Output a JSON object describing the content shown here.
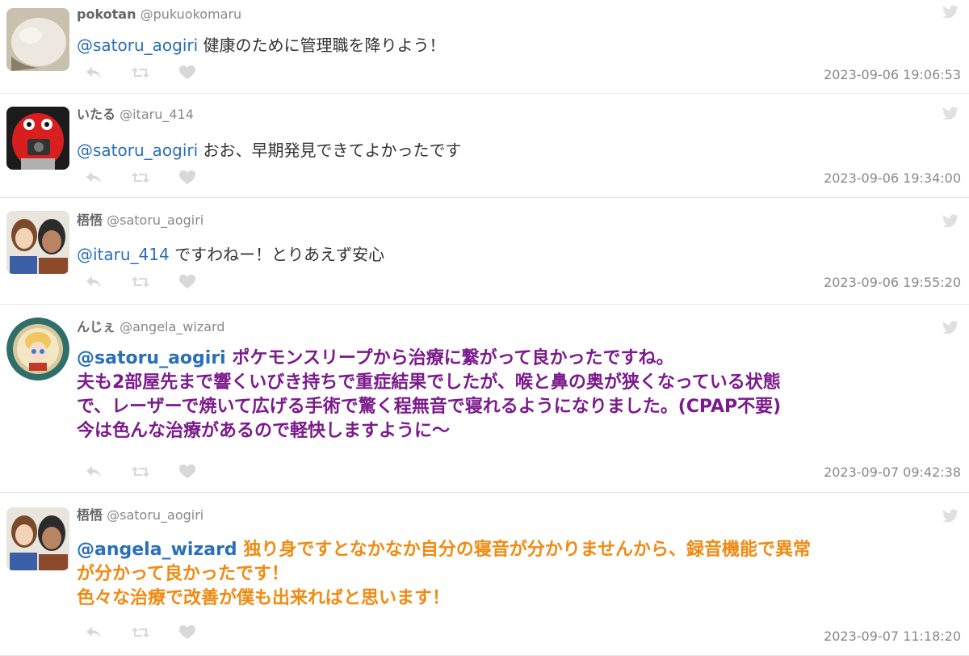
{
  "tweets": [
    {
      "name": "pokotan",
      "handle": "@pukuokomaru",
      "mention": "@satoru_aogiri",
      "text": "健康のために管理職を降りよう！",
      "time": "2023-09-06 19:06:53",
      "avatar": "avatar-round-white"
    },
    {
      "name": "いたる",
      "handle": "@itaru_414",
      "mention": "@satoru_aogiri",
      "text": "おお、早期発見できてよかったです",
      "time": "2023-09-06 19:34:00",
      "avatar": "avatar-red-creature"
    },
    {
      "name": "梧悟",
      "handle": "@satoru_aogiri",
      "mention": "@itaru_414",
      "text": "ですわねー！とりあえず安心",
      "time": "2023-09-06 19:55:20",
      "avatar": "avatar-anime-pair"
    },
    {
      "name": "んじぇ",
      "handle": "@angela_wizard",
      "mention": "@satoru_aogiri",
      "text_lines": [
        "ポケモンスリープから治療に繋がって良かったですね。",
        "夫も2部屋先まで響くいびき持ちで重症結果でしたが、喉と鼻の奥が狭くなっている状態",
        "で、レーザーで焼いて広げる手術で驚く程無音で寝れるようになりました。(CPAP不要)",
        "今は色んな治療があるので軽快しますように〜"
      ],
      "time": "2023-09-07 09:42:38",
      "avatar": "avatar-round-badge"
    },
    {
      "name": "梧悟",
      "handle": "@satoru_aogiri",
      "mention": "@angela_wizard",
      "text_lines": [
        "独り身ですとなかなか自分の寝音が分かりませんから、録音機能で異常",
        "が分かって良かったです！",
        "色々な治療で改善が僕も出来ればと思います！"
      ],
      "time": "2023-09-07 11:18:20",
      "avatar": "avatar-anime-pair"
    }
  ],
  "colors": {
    "mention": "#2a6fb8",
    "purple_text": "#7b1a8c",
    "orange_text": "#f08a12",
    "icon": "#d8d8d8"
  },
  "icons": [
    "reply-icon",
    "retweet-icon",
    "like-icon",
    "twitter-bird-icon"
  ]
}
